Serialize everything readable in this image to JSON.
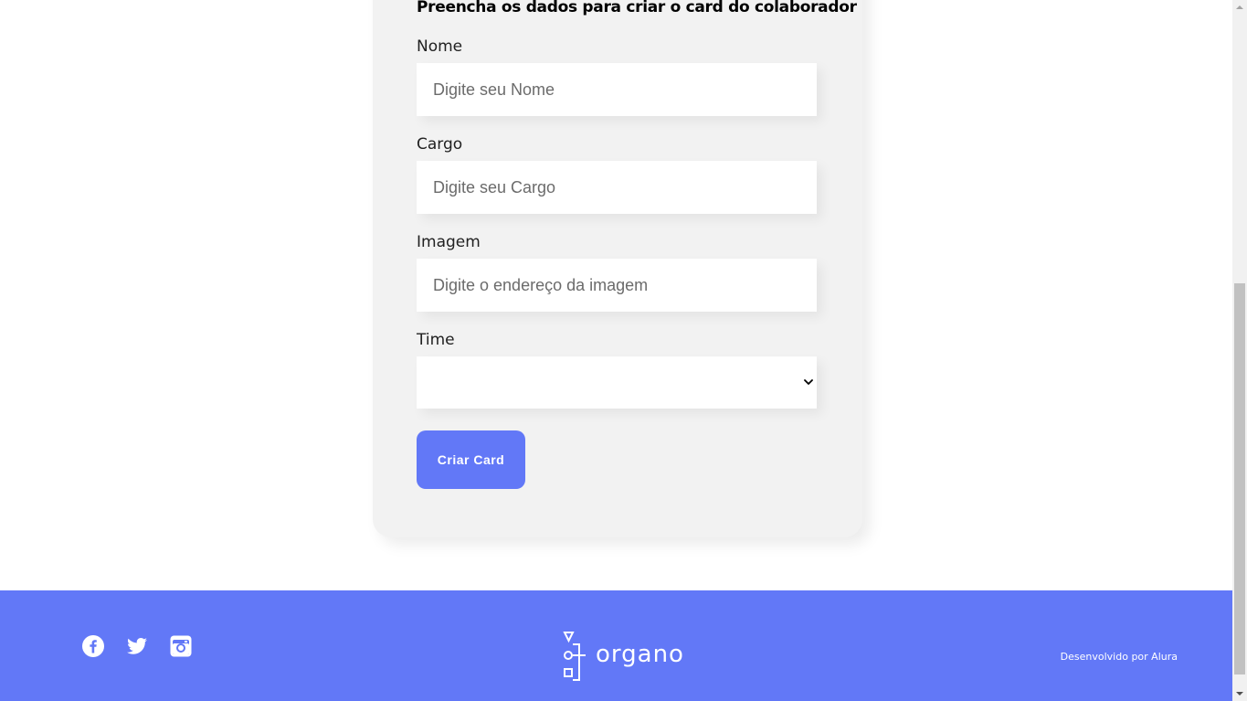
{
  "form": {
    "title": "Preencha os dados para criar o card do colaborador",
    "fields": [
      {
        "label": "Nome",
        "placeholder": "Digite seu Nome",
        "value": ""
      },
      {
        "label": "Cargo",
        "placeholder": "Digite seu Cargo",
        "value": ""
      },
      {
        "label": "Imagem",
        "placeholder": "Digite o endereço da imagem",
        "value": ""
      }
    ],
    "select": {
      "label": "Time",
      "value": ""
    },
    "submit_label": "Criar Card"
  },
  "footer": {
    "social": [
      {
        "icon": "facebook-icon"
      },
      {
        "icon": "twitter-icon"
      },
      {
        "icon": "instagram-icon"
      }
    ],
    "logo_text": "organo",
    "credit": "Desenvolvido por Alura"
  },
  "colors": {
    "accent": "#6278f7",
    "card_background": "#f2f2f2",
    "input_background": "#ffffff"
  }
}
